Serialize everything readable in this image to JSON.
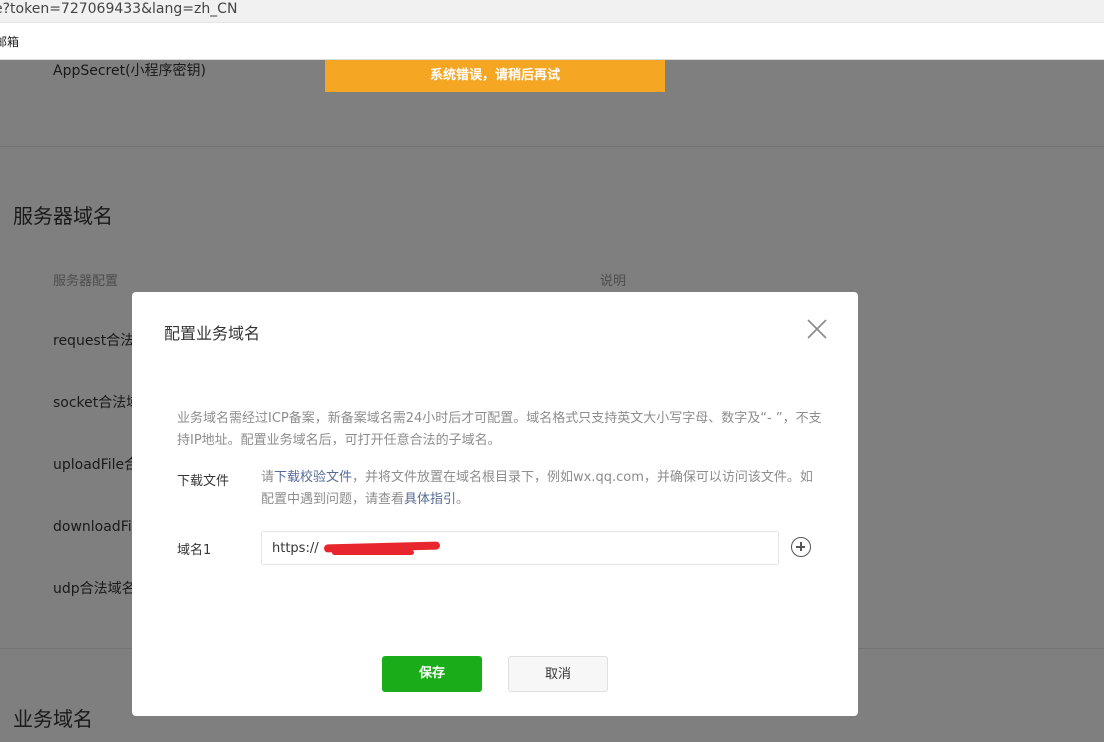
{
  "browser": {
    "url": "e?token=727069433&lang=zh_CN",
    "bookmark": "邮箱"
  },
  "page": {
    "appsecret_label": "AppSecret(小程序密钥)",
    "toast": "系统错误，请稍后再试",
    "server_section_title": "服务器域名",
    "col_config": "服务器配置",
    "col_desc": "说明",
    "rows": [
      "request合法域名",
      "socket合法域名",
      "uploadFile合法域名",
      "downloadFile合法域名",
      "udp合法域名"
    ],
    "business_section_title": "业务域名"
  },
  "dialog": {
    "title": "配置业务域名",
    "intro": "业务域名需经过ICP备案，新备案域名需24小时后才可配置。域名格式只支持英文大小写字母、数字及“- ”，不支持IP地址。配置业务域名后，可打开任意合法的子域名。",
    "download_label": "下载文件",
    "download_prefix": "请",
    "download_link": "下载校验文件",
    "download_mid": "，并将文件放置在域名根目录下，例如wx.qq.com，并确保可以访问该文件。如配置中遇到问题，请查看",
    "guide_link": "具体指引",
    "download_suffix": "。",
    "domain_label": "域名1",
    "domain_value": "https://",
    "save": "保存",
    "cancel": "取消"
  },
  "colors": {
    "primary": "#1aad19",
    "toast": "#f5a623",
    "link": "#576b95",
    "redaction": "#e8262e"
  }
}
